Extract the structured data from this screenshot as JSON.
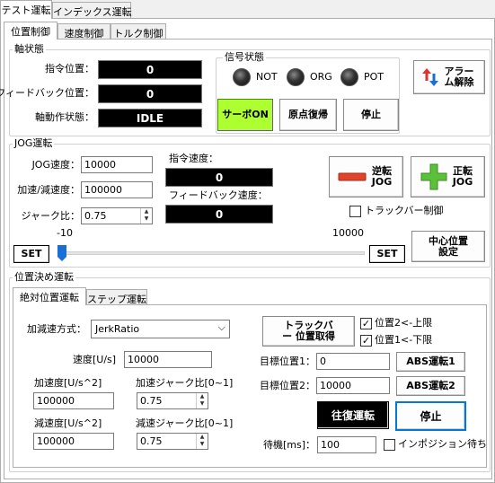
{
  "main_tabs": [
    {
      "label": "テスト運転"
    },
    {
      "label": "インデックス運転"
    }
  ],
  "sub_tabs": [
    {
      "label": "位置制御"
    },
    {
      "label": "速度制御"
    },
    {
      "label": "トルク制御"
    }
  ],
  "axis_state": {
    "title": "軸状態",
    "command_position_label": "指令位置：",
    "command_position_value": "0",
    "feedback_position_label": "フィードバック位置：",
    "feedback_position_value": "0",
    "axis_status_label": "軸動作状態：",
    "axis_status_value": "IDLE"
  },
  "signal_state": {
    "title": "信号状態",
    "not_label": "NOT",
    "org_label": "ORG",
    "pot_label": "POT"
  },
  "buttons": {
    "servo_on": "サーボON",
    "home_return": "原点復帰",
    "stop": "停止",
    "alarm_reset": "アラーム解除"
  },
  "jog": {
    "title": "JOG運転",
    "speed_label": "JOG速度：",
    "speed_value": "10000",
    "accel_label": "加速/減速度：",
    "accel_value": "100000",
    "jerk_label": "ジャーク比：",
    "jerk_value": "0.75",
    "cmd_speed_label": "指令速度：",
    "cmd_speed_value": "0",
    "fb_speed_label": "フィードバック速度：",
    "fb_speed_value": "0",
    "reverse_jog": "逆転 JOG",
    "forward_jog": "正転 JOG",
    "trackbar_control_label": "トラックバー制御",
    "slider_min": "-10",
    "slider_max": "10000",
    "set_left": "SET",
    "set_right": "SET",
    "center_set": "中心位置 設定",
    "slider_fraction": 0.0
  },
  "positioning": {
    "title": "位置決め運転",
    "tabs": [
      {
        "label": "絶対位置運転"
      },
      {
        "label": "ステップ運転"
      }
    ],
    "accel_mode_label": "加減速方式：",
    "accel_mode_value": "JerkRatio",
    "speed_label": "速度[U/s]",
    "speed_value": "10000",
    "accel_label": "加速度[U/s^2]",
    "accel_value": "100000",
    "accel_jerk_label": "加速ジャーク比[0~1]",
    "accel_jerk_value": "0.75",
    "decel_label": "減速度[U/s^2]",
    "decel_value": "100000",
    "decel_jerk_label": "減速ジャーク比[0~1]",
    "decel_jerk_value": "0.75",
    "trackbar_get": "トラックバー 位置取得",
    "pos2_upper_label": "位置2<-上限",
    "pos1_lower_label": "位置1<-下限",
    "target1_label": "目標位置1：",
    "target1_value": "0",
    "target2_label": "目標位置2：",
    "target2_value": "10000",
    "abs1_button": "ABS運転1",
    "abs2_button": "ABS運転2",
    "reciprocate_button": "往復運転",
    "stop_button": "停止",
    "wait_label": "待機[ms]：",
    "wait_value": "100",
    "in_position_label": "インポジション待ち"
  },
  "colors": {
    "servo_on_bg": "#adff2f",
    "display_bg": "#000000",
    "reverse_red": "#e0442c",
    "forward_green": "#5cc13a",
    "focus_blue": "#0078d7",
    "slider_blue": "#1a6fd6"
  }
}
